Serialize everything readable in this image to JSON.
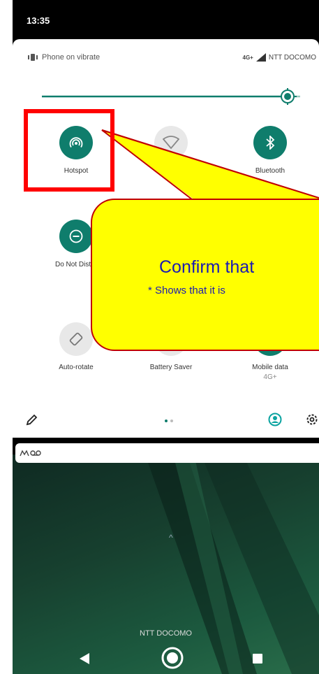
{
  "status_bar": {
    "time": "13:35"
  },
  "qs_header": {
    "vibrate_label": "Phone on vibrate",
    "network_type": "4G+",
    "carrier": "NTT DOCOMO"
  },
  "tiles": [
    {
      "label": "Hotspot",
      "icon": "hotspot-icon",
      "state": "on"
    },
    {
      "label": "",
      "icon": "wifi-icon",
      "state": "off"
    },
    {
      "label": "Bluetooth",
      "icon": "bluetooth-icon",
      "state": "on"
    },
    {
      "label": "Do Not Distur",
      "icon": "dnd-icon",
      "state": "on"
    },
    {
      "label": "Auto-rotate",
      "icon": "rotate-icon",
      "state": "off"
    },
    {
      "label": "Battery Saver",
      "icon": "battery-icon",
      "state": "off"
    },
    {
      "label": "Mobile data",
      "sub": "4G+",
      "icon": "mobile-data-icon",
      "state": "on"
    }
  ],
  "callout": {
    "main": "Confirm that",
    "sub": "* Shows that it is"
  },
  "bottom": {
    "page_dots": 2,
    "active_page": 1
  },
  "lock": {
    "carrier": "NTT DOCOMO"
  },
  "colors": {
    "accent": "#0f7d6c",
    "callout_fill": "#ffff00",
    "callout_border": "#c00000",
    "highlight": "#ff0000"
  }
}
